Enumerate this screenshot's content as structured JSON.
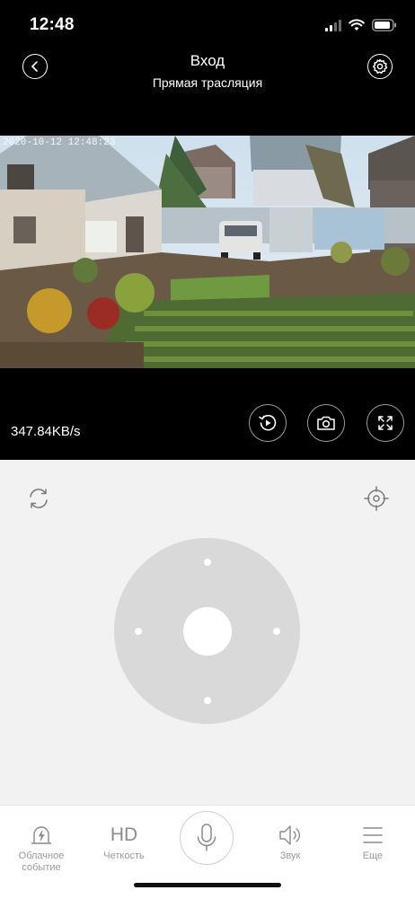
{
  "status_bar": {
    "time": "12:48"
  },
  "header": {
    "title": "Вход",
    "subtitle": "Прямая трасляция"
  },
  "video": {
    "timestamp": "2020-10-12 12:48:23",
    "bitrate": "347.84KB/s"
  },
  "tabs": [
    {
      "label_line1": "Облачное",
      "label_line2": "событие",
      "icon": "cloud-event-icon"
    },
    {
      "glyph": "HD",
      "label_line1": "Четкость",
      "icon": "hd-icon"
    },
    {
      "icon": "microphone-icon"
    },
    {
      "label_line1": "Звук",
      "icon": "speaker-icon"
    },
    {
      "label_line1": "Еще",
      "icon": "menu-icon"
    }
  ],
  "colors": {
    "dark_bg": "#000000",
    "control_bg": "#f2f2f2",
    "ptz_ring": "#d9d9d9",
    "icon_gray": "#9a9a9a"
  }
}
